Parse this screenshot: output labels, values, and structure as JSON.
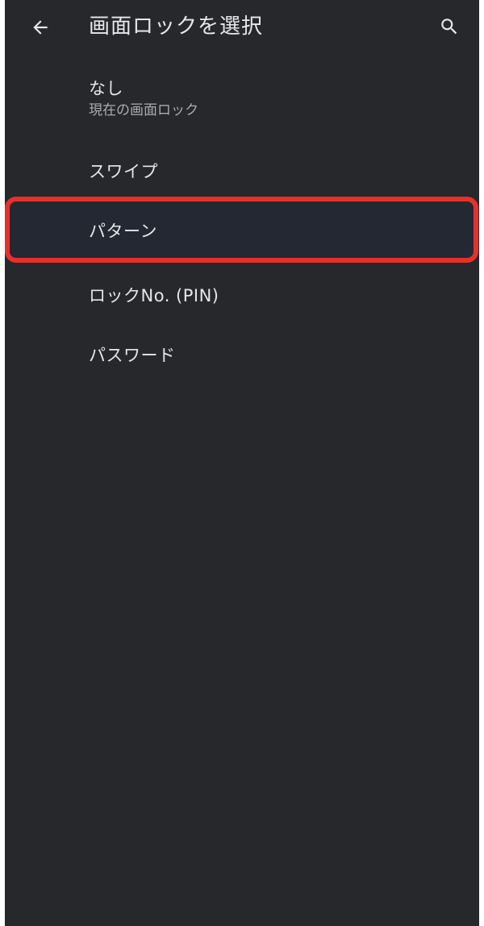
{
  "appbar": {
    "title": "画面ロックを選択",
    "back_icon": "arrow-left-icon",
    "search_icon": "search-icon"
  },
  "options": [
    {
      "label": "なし",
      "summary": "現在の画面ロック"
    },
    {
      "label": "スワイプ"
    },
    {
      "label": "パターン",
      "highlighted": true
    },
    {
      "label": "ロックNo. (PIN)"
    },
    {
      "label": "パスワード"
    }
  ],
  "colors": {
    "background": "#26282c",
    "text": "#e6e6e8",
    "summary_text": "#a9abaf",
    "highlight_border": "#e8302a",
    "highlight_fill": "#242833"
  }
}
